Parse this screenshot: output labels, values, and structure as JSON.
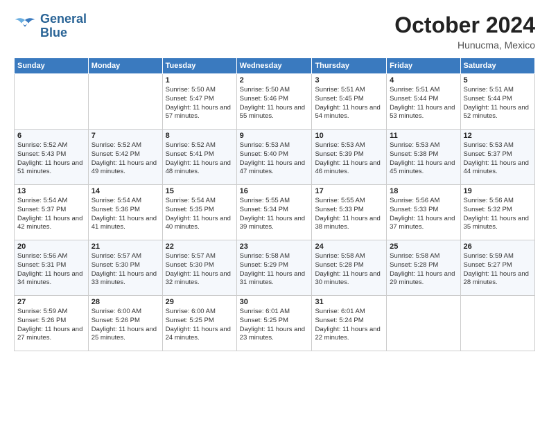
{
  "header": {
    "logo_line1": "General",
    "logo_line2": "Blue",
    "month": "October 2024",
    "location": "Hunucma, Mexico"
  },
  "weekdays": [
    "Sunday",
    "Monday",
    "Tuesday",
    "Wednesday",
    "Thursday",
    "Friday",
    "Saturday"
  ],
  "weeks": [
    [
      {
        "day": "",
        "sunrise": "",
        "sunset": "",
        "daylight": ""
      },
      {
        "day": "",
        "sunrise": "",
        "sunset": "",
        "daylight": ""
      },
      {
        "day": "1",
        "sunrise": "Sunrise: 5:50 AM",
        "sunset": "Sunset: 5:47 PM",
        "daylight": "Daylight: 11 hours and 57 minutes."
      },
      {
        "day": "2",
        "sunrise": "Sunrise: 5:50 AM",
        "sunset": "Sunset: 5:46 PM",
        "daylight": "Daylight: 11 hours and 55 minutes."
      },
      {
        "day": "3",
        "sunrise": "Sunrise: 5:51 AM",
        "sunset": "Sunset: 5:45 PM",
        "daylight": "Daylight: 11 hours and 54 minutes."
      },
      {
        "day": "4",
        "sunrise": "Sunrise: 5:51 AM",
        "sunset": "Sunset: 5:44 PM",
        "daylight": "Daylight: 11 hours and 53 minutes."
      },
      {
        "day": "5",
        "sunrise": "Sunrise: 5:51 AM",
        "sunset": "Sunset: 5:44 PM",
        "daylight": "Daylight: 11 hours and 52 minutes."
      }
    ],
    [
      {
        "day": "6",
        "sunrise": "Sunrise: 5:52 AM",
        "sunset": "Sunset: 5:43 PM",
        "daylight": "Daylight: 11 hours and 51 minutes."
      },
      {
        "day": "7",
        "sunrise": "Sunrise: 5:52 AM",
        "sunset": "Sunset: 5:42 PM",
        "daylight": "Daylight: 11 hours and 49 minutes."
      },
      {
        "day": "8",
        "sunrise": "Sunrise: 5:52 AM",
        "sunset": "Sunset: 5:41 PM",
        "daylight": "Daylight: 11 hours and 48 minutes."
      },
      {
        "day": "9",
        "sunrise": "Sunrise: 5:53 AM",
        "sunset": "Sunset: 5:40 PM",
        "daylight": "Daylight: 11 hours and 47 minutes."
      },
      {
        "day": "10",
        "sunrise": "Sunrise: 5:53 AM",
        "sunset": "Sunset: 5:39 PM",
        "daylight": "Daylight: 11 hours and 46 minutes."
      },
      {
        "day": "11",
        "sunrise": "Sunrise: 5:53 AM",
        "sunset": "Sunset: 5:38 PM",
        "daylight": "Daylight: 11 hours and 45 minutes."
      },
      {
        "day": "12",
        "sunrise": "Sunrise: 5:53 AM",
        "sunset": "Sunset: 5:37 PM",
        "daylight": "Daylight: 11 hours and 44 minutes."
      }
    ],
    [
      {
        "day": "13",
        "sunrise": "Sunrise: 5:54 AM",
        "sunset": "Sunset: 5:37 PM",
        "daylight": "Daylight: 11 hours and 42 minutes."
      },
      {
        "day": "14",
        "sunrise": "Sunrise: 5:54 AM",
        "sunset": "Sunset: 5:36 PM",
        "daylight": "Daylight: 11 hours and 41 minutes."
      },
      {
        "day": "15",
        "sunrise": "Sunrise: 5:54 AM",
        "sunset": "Sunset: 5:35 PM",
        "daylight": "Daylight: 11 hours and 40 minutes."
      },
      {
        "day": "16",
        "sunrise": "Sunrise: 5:55 AM",
        "sunset": "Sunset: 5:34 PM",
        "daylight": "Daylight: 11 hours and 39 minutes."
      },
      {
        "day": "17",
        "sunrise": "Sunrise: 5:55 AM",
        "sunset": "Sunset: 5:33 PM",
        "daylight": "Daylight: 11 hours and 38 minutes."
      },
      {
        "day": "18",
        "sunrise": "Sunrise: 5:56 AM",
        "sunset": "Sunset: 5:33 PM",
        "daylight": "Daylight: 11 hours and 37 minutes."
      },
      {
        "day": "19",
        "sunrise": "Sunrise: 5:56 AM",
        "sunset": "Sunset: 5:32 PM",
        "daylight": "Daylight: 11 hours and 35 minutes."
      }
    ],
    [
      {
        "day": "20",
        "sunrise": "Sunrise: 5:56 AM",
        "sunset": "Sunset: 5:31 PM",
        "daylight": "Daylight: 11 hours and 34 minutes."
      },
      {
        "day": "21",
        "sunrise": "Sunrise: 5:57 AM",
        "sunset": "Sunset: 5:30 PM",
        "daylight": "Daylight: 11 hours and 33 minutes."
      },
      {
        "day": "22",
        "sunrise": "Sunrise: 5:57 AM",
        "sunset": "Sunset: 5:30 PM",
        "daylight": "Daylight: 11 hours and 32 minutes."
      },
      {
        "day": "23",
        "sunrise": "Sunrise: 5:58 AM",
        "sunset": "Sunset: 5:29 PM",
        "daylight": "Daylight: 11 hours and 31 minutes."
      },
      {
        "day": "24",
        "sunrise": "Sunrise: 5:58 AM",
        "sunset": "Sunset: 5:28 PM",
        "daylight": "Daylight: 11 hours and 30 minutes."
      },
      {
        "day": "25",
        "sunrise": "Sunrise: 5:58 AM",
        "sunset": "Sunset: 5:28 PM",
        "daylight": "Daylight: 11 hours and 29 minutes."
      },
      {
        "day": "26",
        "sunrise": "Sunrise: 5:59 AM",
        "sunset": "Sunset: 5:27 PM",
        "daylight": "Daylight: 11 hours and 28 minutes."
      }
    ],
    [
      {
        "day": "27",
        "sunrise": "Sunrise: 5:59 AM",
        "sunset": "Sunset: 5:26 PM",
        "daylight": "Daylight: 11 hours and 27 minutes."
      },
      {
        "day": "28",
        "sunrise": "Sunrise: 6:00 AM",
        "sunset": "Sunset: 5:26 PM",
        "daylight": "Daylight: 11 hours and 25 minutes."
      },
      {
        "day": "29",
        "sunrise": "Sunrise: 6:00 AM",
        "sunset": "Sunset: 5:25 PM",
        "daylight": "Daylight: 11 hours and 24 minutes."
      },
      {
        "day": "30",
        "sunrise": "Sunrise: 6:01 AM",
        "sunset": "Sunset: 5:25 PM",
        "daylight": "Daylight: 11 hours and 23 minutes."
      },
      {
        "day": "31",
        "sunrise": "Sunrise: 6:01 AM",
        "sunset": "Sunset: 5:24 PM",
        "daylight": "Daylight: 11 hours and 22 minutes."
      },
      {
        "day": "",
        "sunrise": "",
        "sunset": "",
        "daylight": ""
      },
      {
        "day": "",
        "sunrise": "",
        "sunset": "",
        "daylight": ""
      }
    ]
  ]
}
